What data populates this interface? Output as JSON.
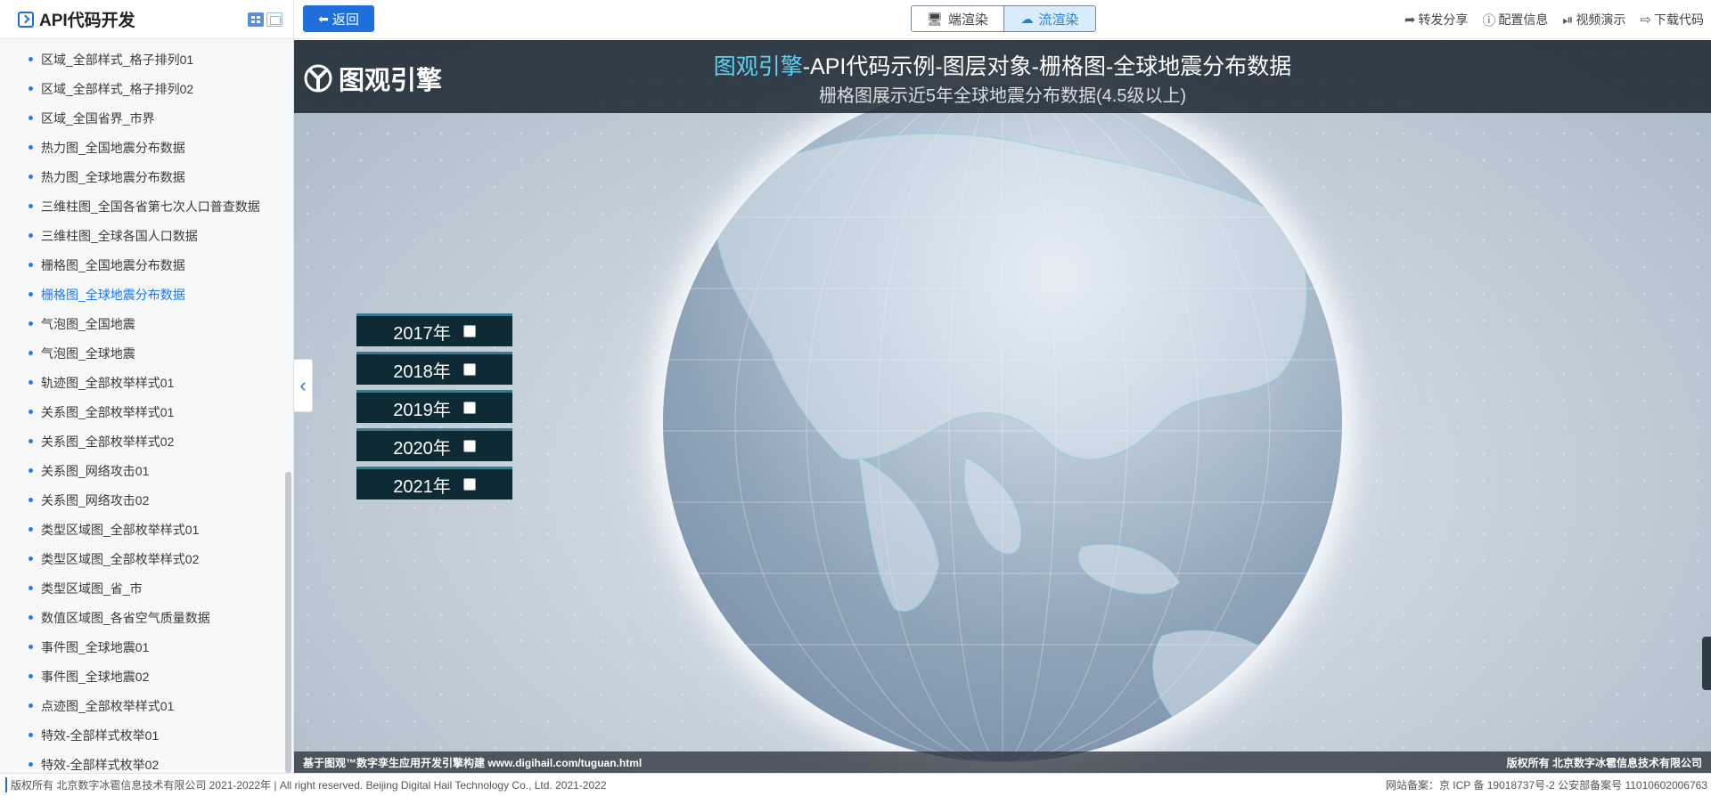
{
  "sidebar": {
    "title": "API代码开发",
    "items": [
      {
        "label": "区域_全部样式_格子排列01",
        "active": false
      },
      {
        "label": "区域_全部样式_格子排列02",
        "active": false
      },
      {
        "label": "区域_全国省界_市界",
        "active": false
      },
      {
        "label": "热力图_全国地震分布数据",
        "active": false
      },
      {
        "label": "热力图_全球地震分布数据",
        "active": false
      },
      {
        "label": "三维柱图_全国各省第七次人口普查数据",
        "active": false
      },
      {
        "label": "三维柱图_全球各国人口数据",
        "active": false
      },
      {
        "label": "栅格图_全国地震分布数据",
        "active": false
      },
      {
        "label": "栅格图_全球地震分布数据",
        "active": true
      },
      {
        "label": "气泡图_全国地震",
        "active": false
      },
      {
        "label": "气泡图_全球地震",
        "active": false
      },
      {
        "label": "轨迹图_全部枚举样式01",
        "active": false
      },
      {
        "label": "关系图_全部枚举样式01",
        "active": false
      },
      {
        "label": "关系图_全部枚举样式02",
        "active": false
      },
      {
        "label": "关系图_网络攻击01",
        "active": false
      },
      {
        "label": "关系图_网络攻击02",
        "active": false
      },
      {
        "label": "类型区域图_全部枚举样式01",
        "active": false
      },
      {
        "label": "类型区域图_全部枚举样式02",
        "active": false
      },
      {
        "label": "类型区域图_省_市",
        "active": false
      },
      {
        "label": "数值区域图_各省空气质量数据",
        "active": false
      },
      {
        "label": "事件图_全球地震01",
        "active": false
      },
      {
        "label": "事件图_全球地震02",
        "active": false
      },
      {
        "label": "点迹图_全部枚举样式01",
        "active": false
      },
      {
        "label": "特效-全部样式枚举01",
        "active": false
      },
      {
        "label": "特效-全部样式枚举02",
        "active": false
      }
    ]
  },
  "toolbar": {
    "back_label": "返回",
    "render_client": "端渲染",
    "render_stream": "流渲染",
    "actions": {
      "share": "转发分享",
      "config": "配置信息",
      "video": "视频演示",
      "download": "下载代码"
    }
  },
  "viewport": {
    "logo_text": "图观引擎",
    "title_brand": "图观引擎",
    "title_rest": "-API代码示例-图层对象-栅格图-全球地震分布数据",
    "subtitle": "栅格图展示近5年全球地震分布数据(4.5级以上)",
    "years": [
      {
        "label": "2017年",
        "checked": false
      },
      {
        "label": "2018年",
        "checked": false
      },
      {
        "label": "2019年",
        "checked": false
      },
      {
        "label": "2020年",
        "checked": false
      },
      {
        "label": "2021年",
        "checked": false
      }
    ],
    "footer_left": "基于图观™数字孪生应用开发引擎构建 www.digihail.com/tuguan.html",
    "footer_right": "版权所有 北京数字冰雹信息技术有限公司"
  },
  "page_footer": {
    "left": "版权所有 北京数字冰雹信息技术有限公司 2021-2022年 | All right reserved. Beijing Digital Hail Technology Co., Ltd. 2021-2022",
    "right": "网站备案：京 ICP 备 19018737号-2 公安部备案号 11010602006763"
  },
  "icons": {
    "back": "arrow-left-icon",
    "client": "monitor-icon",
    "stream": "cloud-download-icon",
    "share": "share-arrow-icon",
    "config": "info-icon",
    "video": "play-circle-icon",
    "download": "export-icon",
    "collapse": "chevron-left-icon"
  },
  "colors": {
    "accent": "#1e6fd9",
    "active_menu": "#1677ff",
    "title_brand": "#5fd3f3",
    "year_panel_bg": "#0d2a35"
  }
}
